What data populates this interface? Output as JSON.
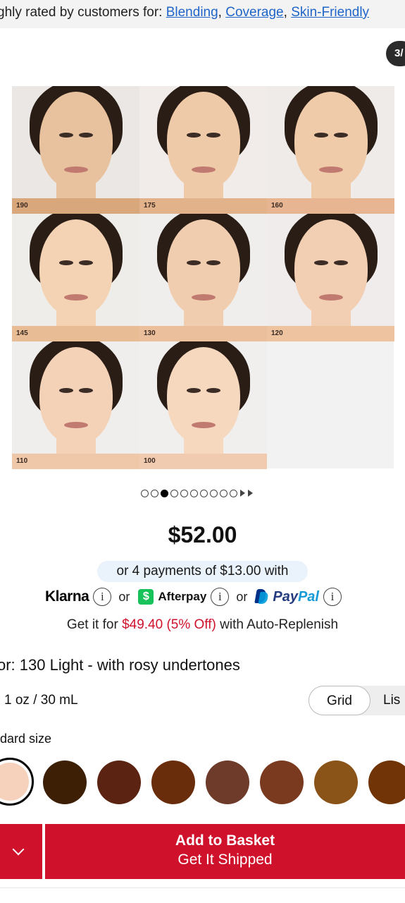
{
  "rating": {
    "prefix": "ghly rated by customers for: ",
    "tags": [
      "Blending",
      "Coverage",
      "Skin-Friendly"
    ],
    "sep": ", "
  },
  "gallery": {
    "counter": "3/",
    "shades": [
      {
        "label": "190",
        "skin": "#e8c29e",
        "bg": "#ebe7e4",
        "bar": "#d9a77c"
      },
      {
        "label": "175",
        "skin": "#efcaa8",
        "bg": "#f1ece9",
        "bar": "#e2b38a"
      },
      {
        "label": "160",
        "skin": "#efcbaa",
        "bg": "#eeebe8",
        "bar": "#e7b592"
      },
      {
        "label": "145",
        "skin": "#f3d3b4",
        "bg": "#efedea",
        "bar": "#e8bc94"
      },
      {
        "label": "130",
        "skin": "#f1cdb0",
        "bg": "#f0eeec",
        "bar": "#ebbe9c"
      },
      {
        "label": "120",
        "skin": "#f2cfb2",
        "bg": "#efeceb",
        "bar": "#edc3a0"
      },
      {
        "label": "110",
        "skin": "#f3d2b8",
        "bg": "#f0eeec",
        "bar": "#efc7a9"
      },
      {
        "label": "100",
        "skin": "#f6d8bf",
        "bg": "#f1efee",
        "bar": "#f0cbb0"
      }
    ],
    "dots_total": 10,
    "dots_active": 2
  },
  "price": "$52.00",
  "payments": {
    "pill": "or 4 payments of $13.00 with",
    "klarna": "Klarna",
    "or": "or",
    "afterpay_badge": "$",
    "afterpay": "Afterpay",
    "paypal_a": "Pay",
    "paypal_b": "Pal",
    "info": "i"
  },
  "replenish": {
    "prefix": "Get it for ",
    "deal": "$49.40 (5% Off)",
    "suffix": " with Auto-Replenish"
  },
  "color_line": "or: 130 Light - with rosy undertones",
  "size_line": "1 oz / 30 mL",
  "view_toggle": {
    "grid": "Grid",
    "list": "Lis"
  },
  "std_size": "dard size",
  "swatches": [
    "#f6d2bd",
    "#3d1f06",
    "#5b2412",
    "#6a2d0b",
    "#6e3a2a",
    "#7a3a1f",
    "#8a5318",
    "#713407"
  ],
  "actions": {
    "add_line1": "Add to Basket",
    "add_line2": "Get It Shipped",
    "accent": "#cf112c"
  }
}
